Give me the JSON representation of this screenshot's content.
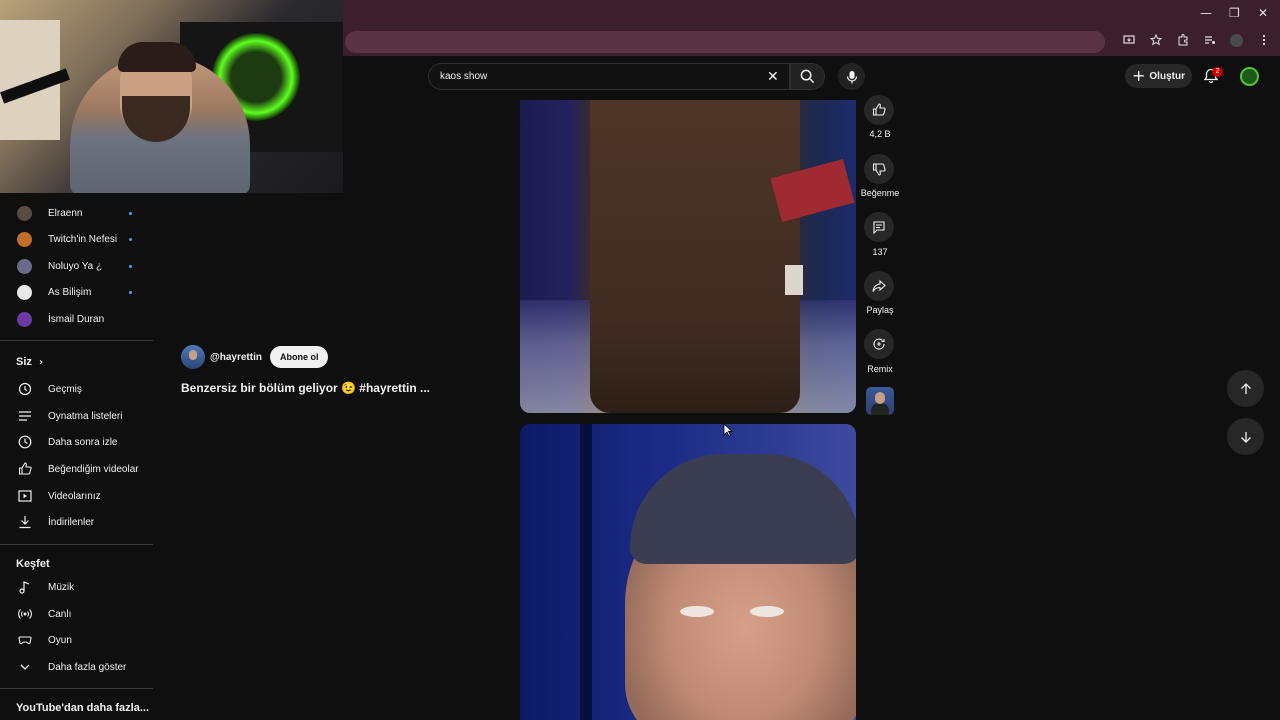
{
  "window": {
    "minimize_glyph": "—",
    "maximize_glyph": "❐",
    "close_glyph": "✕"
  },
  "search": {
    "query": "kaos show",
    "clear_glyph": "✕"
  },
  "header": {
    "create_label": "Oluştur",
    "notification_count": "2"
  },
  "sidebar": {
    "subscriptions": [
      {
        "label": "Elraenn",
        "has_new": true,
        "avatar_color": "#5a4a44"
      },
      {
        "label": "Twitch'in Nefesi",
        "has_new": true,
        "avatar_color": "#c0702a"
      },
      {
        "label": "Noluyo Ya ¿",
        "has_new": true,
        "avatar_color": "#6a6a8a"
      },
      {
        "label": "As Bilişim",
        "has_new": true,
        "avatar_color": "#e8e8e8"
      },
      {
        "label": "İsmail Duran",
        "has_new": false,
        "avatar_color": "#6a3aa0"
      }
    ],
    "you_section_title": "Siz",
    "you_items": [
      {
        "label": "Geçmiş",
        "icon": "history-icon"
      },
      {
        "label": "Oynatma listeleri",
        "icon": "playlist-icon"
      },
      {
        "label": "Daha sonra izle",
        "icon": "clock-icon"
      },
      {
        "label": "Beğendiğim videolar",
        "icon": "thumb-up-icon"
      },
      {
        "label": "Videolarınız",
        "icon": "video-icon"
      },
      {
        "label": "İndirilenler",
        "icon": "download-icon"
      }
    ],
    "explore_title": "Keşfet",
    "explore_items": [
      {
        "label": "Müzik",
        "icon": "music-icon"
      },
      {
        "label": "Canlı",
        "icon": "live-icon"
      },
      {
        "label": "Oyun",
        "icon": "gaming-icon"
      },
      {
        "label": "Daha fazla göster",
        "icon": "chevron-down-icon"
      }
    ],
    "more_from_youtube": "YouTube'dan daha fazla..."
  },
  "short": {
    "channel_handle": "@hayrettin",
    "subscribe_label": "Abone ol",
    "title": "Benzersiz bir bölüm geliyor 😉 #hayrettin ..."
  },
  "actions": {
    "like_count": "4,2 B",
    "dislike_label": "Beğenme",
    "comment_count": "137",
    "share_label": "Paylaş",
    "remix_label": "Remix"
  }
}
